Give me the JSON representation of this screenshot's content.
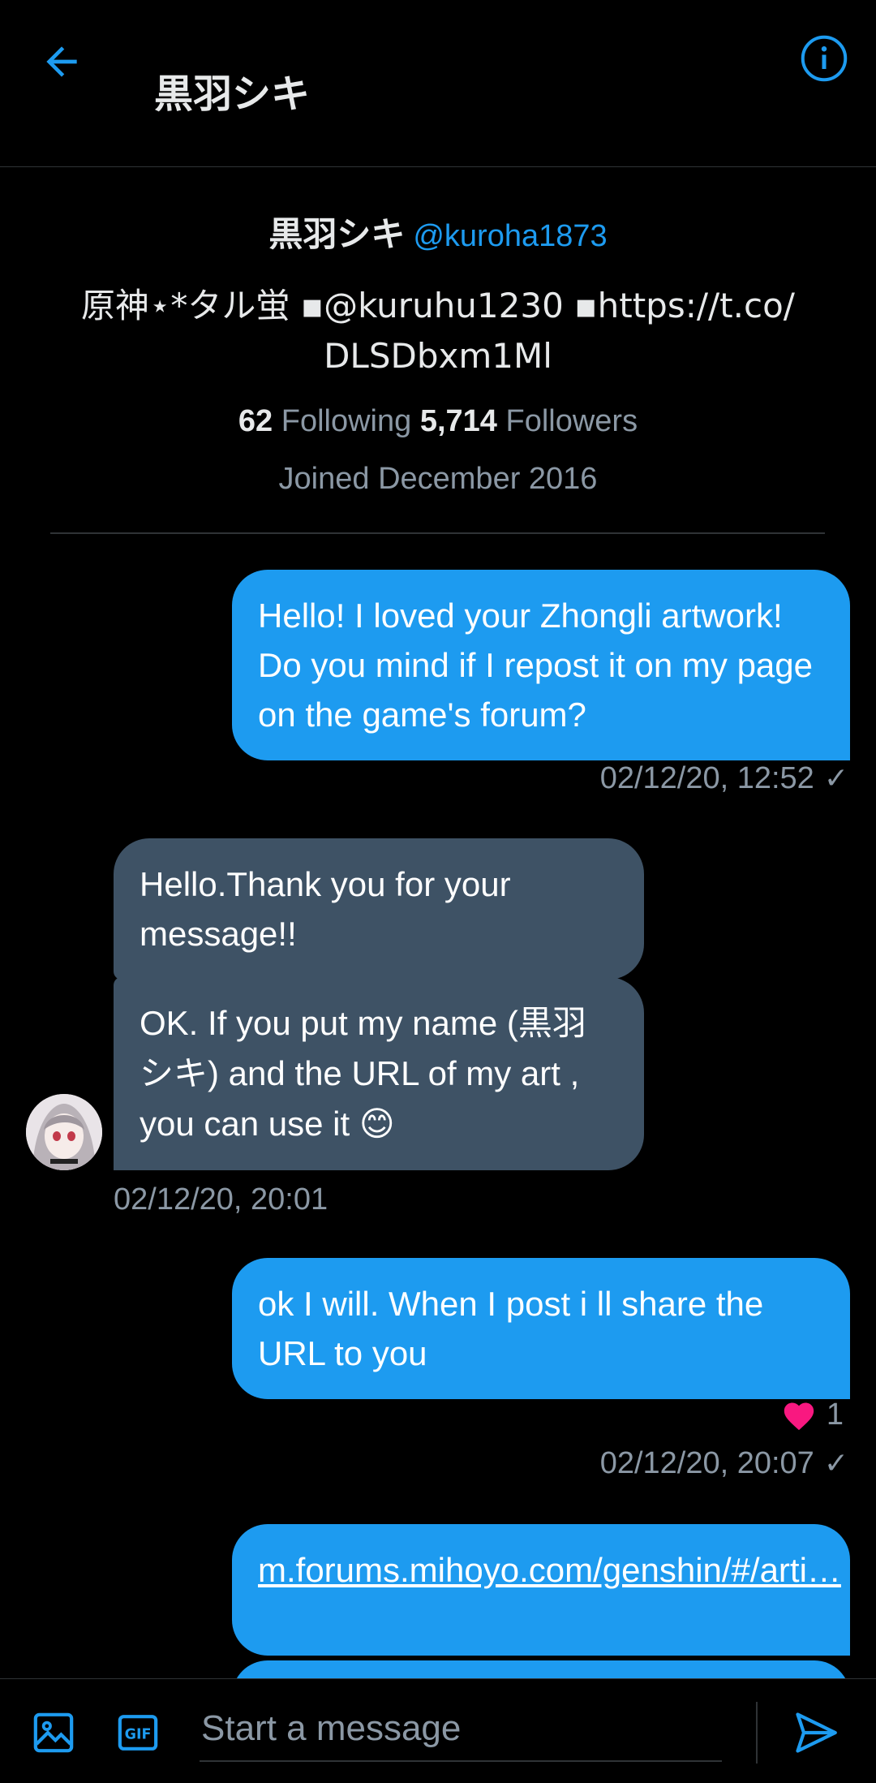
{
  "header": {
    "title": "黒羽シキ"
  },
  "profile": {
    "name": "黒羽シキ",
    "handle": "@kuroha1873",
    "bio": "原神⋆*タル蛍 ▪@kuruhu1230 ▪https://t.co/ DLSDbxm1Ml",
    "following_count": "62",
    "following_label": "Following",
    "followers_count": "5,714",
    "followers_label": "Followers",
    "joined": "Joined December 2016"
  },
  "messages": [
    {
      "text": "Hello! I loved your Zhongli artwork! Do you mind if  I repost it on my page on the game's forum?",
      "time": "02/12/20, 12:52",
      "status": "✓"
    },
    {
      "text": "Hello.Thank you for your message!!"
    },
    {
      "text": "OK. If you put  my name (黒羽シキ) and the URL of my art , you can use it 😊",
      "time": "02/12/20, 20:01"
    },
    {
      "text": "ok I will. When I post i ll share the URL to you",
      "reaction": "1",
      "time": "02/12/20, 20:07",
      "status": "✓"
    },
    {
      "text": "m.forums.mihoyo.com/genshin/#/arti…"
    }
  ],
  "composer": {
    "placeholder": "Start a message"
  },
  "colors": {
    "accent": "#1d9bf0",
    "incoming_bubble": "#3e5265",
    "heart": "#f91880"
  },
  "icons": [
    "back-arrow-icon",
    "info-icon",
    "image-icon",
    "gif-icon",
    "send-icon",
    "heart-icon"
  ]
}
